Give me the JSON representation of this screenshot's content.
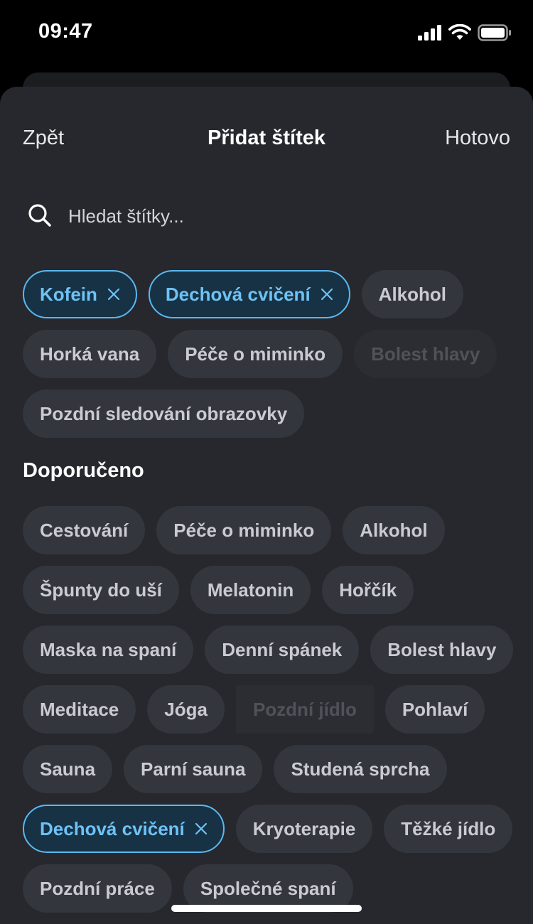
{
  "status_bar": {
    "time": "09:47"
  },
  "nav": {
    "back_label": "Zpět",
    "title": "Přidat štítek",
    "done_label": "Hotovo"
  },
  "search": {
    "placeholder": "Hledat štítky..."
  },
  "selected_tags": [
    {
      "label": "Kofein",
      "state": "selected"
    },
    {
      "label": "Dechová cvičení",
      "state": "selected"
    },
    {
      "label": "Alkohol",
      "state": "default"
    },
    {
      "label": "Horká vana",
      "state": "default"
    },
    {
      "label": "Péče o miminko",
      "state": "default"
    },
    {
      "label": "Bolest hlavy",
      "state": "disabled"
    },
    {
      "label": "Pozdní sledování obrazovky",
      "state": "default"
    }
  ],
  "recommended": {
    "title": "Doporučeno",
    "tags": [
      {
        "label": "Cestování",
        "state": "default"
      },
      {
        "label": "Péče o miminko",
        "state": "default"
      },
      {
        "label": "Alkohol",
        "state": "default"
      },
      {
        "label": "Špunty do uší",
        "state": "default"
      },
      {
        "label": "Melatonin",
        "state": "default"
      },
      {
        "label": "Hořčík",
        "state": "default"
      },
      {
        "label": "Maska na spaní",
        "state": "default"
      },
      {
        "label": "Denní spánek",
        "state": "default"
      },
      {
        "label": "Bolest hlavy",
        "state": "default"
      },
      {
        "label": "Meditace",
        "state": "default"
      },
      {
        "label": "Jóga",
        "state": "default"
      },
      {
        "label": "Pozdní jídlo",
        "state": "disabled-square"
      },
      {
        "label": "Pohlaví",
        "state": "default"
      },
      {
        "label": "Sauna",
        "state": "default"
      },
      {
        "label": "Parní sauna",
        "state": "default"
      },
      {
        "label": "Studená sprcha",
        "state": "default"
      },
      {
        "label": "Dechová cvičení",
        "state": "selected"
      },
      {
        "label": "Kryoterapie",
        "state": "default"
      },
      {
        "label": "Těžké jídlo",
        "state": "default"
      },
      {
        "label": "Pozdní práce",
        "state": "default"
      },
      {
        "label": "Společné spaní",
        "state": "default"
      }
    ]
  },
  "colors": {
    "background": "#000000",
    "sheet": "#26282d",
    "chip": "#34363d",
    "accent": "#5ab8f2"
  }
}
